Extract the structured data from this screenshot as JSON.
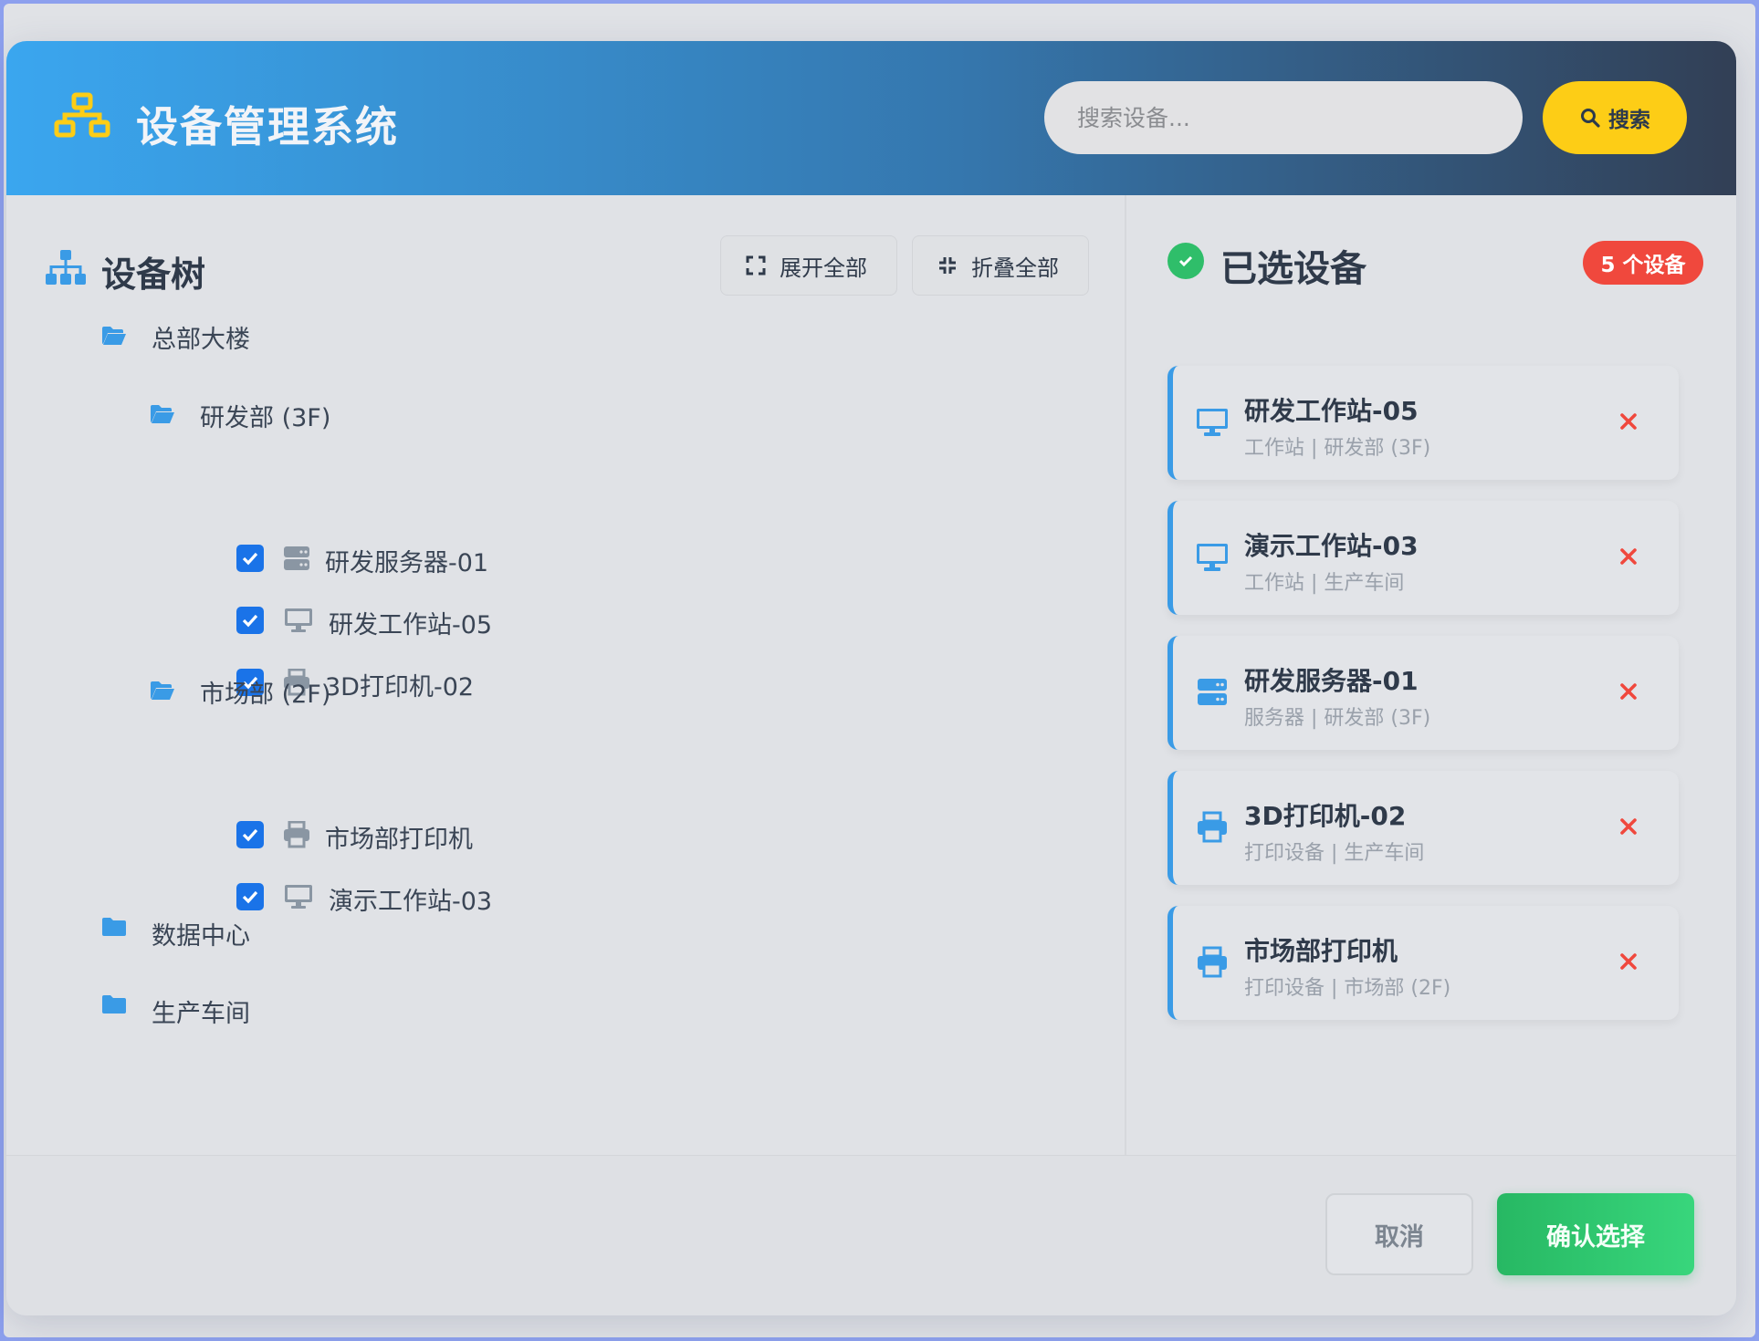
{
  "header": {
    "title": "设备管理系统",
    "logo_icon": "network-icon",
    "search_placeholder": "搜索设备...",
    "search_button": "搜索"
  },
  "tree": {
    "title": "设备树",
    "expand_all": "展开全部",
    "collapse_all": "折叠全部",
    "nodes": [
      {
        "label": "总部大楼",
        "type": "folder",
        "expanded": true
      },
      {
        "label": "研发部 (3F)",
        "type": "folder",
        "expanded": true
      },
      {
        "label": "研发服务器-01",
        "type": "server",
        "checked": true
      },
      {
        "label": "研发工作站-05",
        "type": "workstation",
        "checked": true
      },
      {
        "label": "3D打印机-02",
        "type": "printer",
        "checked": true
      },
      {
        "label": "市场部 (2F)",
        "type": "folder",
        "expanded": true
      },
      {
        "label": "市场部打印机",
        "type": "printer",
        "checked": true
      },
      {
        "label": "演示工作站-03",
        "type": "workstation",
        "checked": true
      },
      {
        "label": "数据中心",
        "type": "folder",
        "expanded": false
      },
      {
        "label": "生产车间",
        "type": "folder",
        "expanded": false
      }
    ]
  },
  "selected": {
    "title": "已选设备",
    "count_label": "5 个设备",
    "items": [
      {
        "name": "研发工作站-05",
        "meta": "工作站 | 研发部 (3F)",
        "icon": "desktop-icon"
      },
      {
        "name": "演示工作站-03",
        "meta": "工作站 | 生产车间",
        "icon": "desktop-icon"
      },
      {
        "name": "研发服务器-01",
        "meta": "服务器 | 研发部 (3F)",
        "icon": "server-icon"
      },
      {
        "name": "3D打印机-02",
        "meta": "打印设备 | 生产车间",
        "icon": "printer-icon"
      },
      {
        "name": "市场部打印机",
        "meta": "打印设备 | 市场部 (2F)",
        "icon": "printer-icon"
      }
    ]
  },
  "footer": {
    "cancel": "取消",
    "confirm": "确认选择"
  },
  "colors": {
    "accent_blue": "#3a9be6",
    "search_yellow": "#fdcd16",
    "confirm_green": "#27b863",
    "badge_red": "#f0483d",
    "checkbox_blue": "#1a73e8"
  }
}
